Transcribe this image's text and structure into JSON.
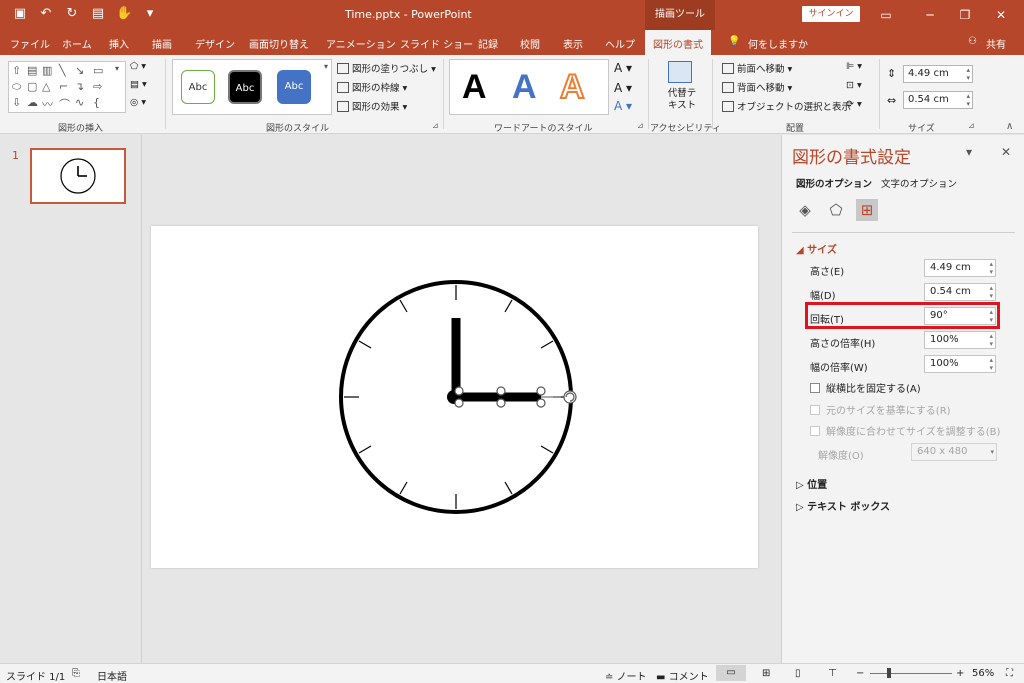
{
  "window": {
    "title": "Time.pptx  -  PowerPoint",
    "context_tab": "描画ツール",
    "signin": "サインイン"
  },
  "tabs": [
    "ファイル",
    "ホーム",
    "挿入",
    "描画",
    "デザイン",
    "画面切り替え",
    "アニメーション",
    "スライド ショー",
    "記録",
    "校閲",
    "表示",
    "ヘルプ",
    "図形の書式"
  ],
  "tellme": "何をしますか",
  "share": "共有",
  "ribbon": {
    "groups": {
      "insert_shapes": "図形の挿入",
      "shape_styles": "図形のスタイル",
      "wordart_styles": "ワードアートのスタイル",
      "accessibility": "アクセシビリティ",
      "arrange": "配置",
      "size": "サイズ"
    },
    "style_chip": "Abc",
    "fill": "図形の塗りつぶし",
    "outline": "図形の枠線",
    "effects": "図形の効果",
    "alt_text": "代替テキスト",
    "bring_forward": "前面へ移動",
    "send_backward": "背面へ移動",
    "selection_pane": "オブジェクトの選択と表示",
    "height": "4.49 cm",
    "width": "0.54 cm",
    "wordart_letter": "A"
  },
  "thumbnails": {
    "slide_number": "1"
  },
  "pane": {
    "title": "図形の書式設定",
    "tab_shape": "図形のオプション",
    "tab_text": "文字のオプション",
    "section_size": "サイズ",
    "height_label": "高さ(E)",
    "height_value": "4.49 cm",
    "width_label": "幅(D)",
    "width_value": "0.54 cm",
    "rotation_label": "回転(T)",
    "rotation_value": "90°",
    "scale_height_label": "高さの倍率(H)",
    "scale_height_value": "100%",
    "scale_width_label": "幅の倍率(W)",
    "scale_width_value": "100%",
    "lock_aspect": "縦横比を固定する(A)",
    "relative_original": "元のサイズを基準にする(R)",
    "best_scale": "解像度に合わせてサイズを調整する(B)",
    "resolution_label": "解像度(O)",
    "resolution_value": "640 x 480",
    "section_position": "位置",
    "section_textbox": "テキスト ボックス"
  },
  "status": {
    "slide": "スライド 1/1",
    "language": "日本語",
    "notes": "ノート",
    "comments": "コメント",
    "zoom": "56%"
  },
  "colors": {
    "accent": "#b7472a",
    "highlight": "#e0141e"
  }
}
